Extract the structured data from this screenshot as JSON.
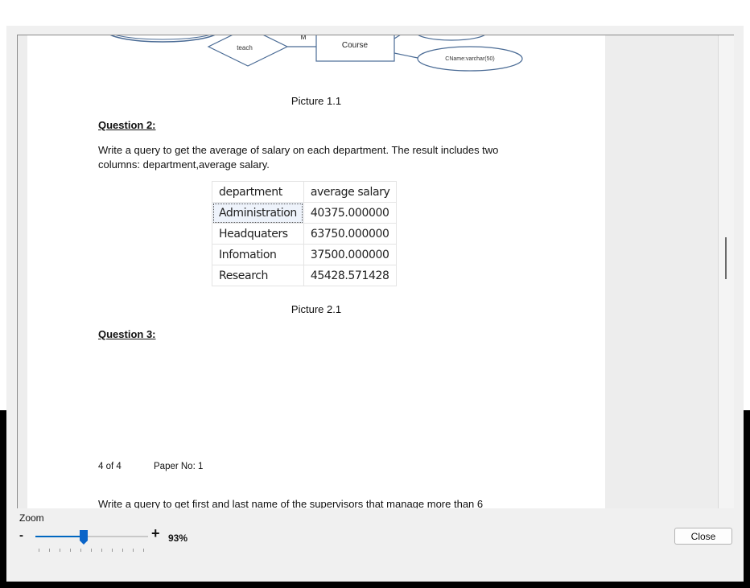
{
  "document": {
    "erd": {
      "relationship_label": "teach",
      "cardinality_label": "M",
      "entity_label": "Course",
      "attribute_label": "CName:varchar(50)"
    },
    "picture_1_caption": "Picture 1.1",
    "question_2": {
      "heading": "Question 2:",
      "line_1": "Write a query to get the average of salary on each department. The result includes two",
      "line_2": "columns: department,average salary."
    },
    "result_table": {
      "columns": [
        "department",
        "average salary"
      ],
      "rows": [
        [
          "Administration",
          "40375.000000"
        ],
        [
          "Headquaters",
          "63750.000000"
        ],
        [
          "Infomation",
          "37500.000000"
        ],
        [
          "Research",
          "45428.571428"
        ]
      ]
    },
    "picture_2_caption": "Picture 2.1",
    "question_3": {
      "heading": "Question 3:"
    },
    "footer": {
      "page_counter": "4 of 4",
      "paper_no": "Paper No: 1"
    },
    "next_text": "Write a query to get first and last name of the supervisors that manage more than 6"
  },
  "zoom": {
    "label": "Zoom",
    "minus_symbol": "-",
    "plus_symbol": "+",
    "value_text": "93%",
    "level_percent": 93
  },
  "close_label": "Close",
  "colors": {
    "erd_stroke": "#4a6b95",
    "slider_accent": "#0a64c8"
  }
}
